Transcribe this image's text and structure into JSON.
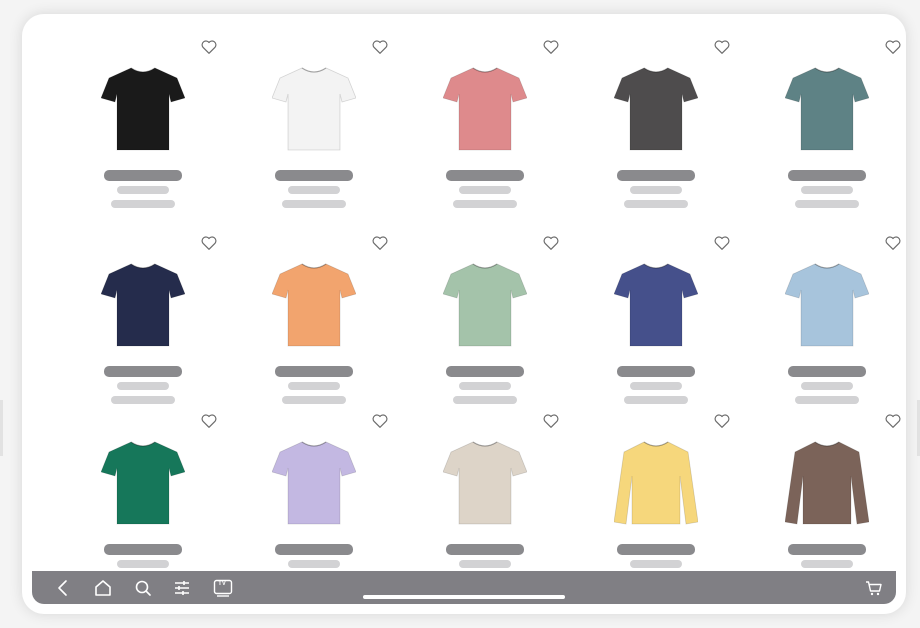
{
  "grid": {
    "products": [
      {
        "color": "#1a1a1a",
        "style": "short"
      },
      {
        "color": "#f3f3f3",
        "style": "short"
      },
      {
        "color": "#de8a8c",
        "style": "short"
      },
      {
        "color": "#4e4c4d",
        "style": "short"
      },
      {
        "color": "#5e8285",
        "style": "short"
      },
      {
        "color": "#252c4c",
        "style": "short"
      },
      {
        "color": "#f2a46e",
        "style": "short"
      },
      {
        "color": "#a4c3aa",
        "style": "short"
      },
      {
        "color": "#45508b",
        "style": "short"
      },
      {
        "color": "#a7c4dc",
        "style": "short"
      },
      {
        "color": "#16775a",
        "style": "short"
      },
      {
        "color": "#c3b8e2",
        "style": "short"
      },
      {
        "color": "#ddd4c8",
        "style": "short"
      },
      {
        "color": "#f6d77c",
        "style": "long"
      },
      {
        "color": "#7b6359",
        "style": "long"
      }
    ]
  },
  "navbar": {
    "items": [
      "back-icon",
      "home-icon",
      "search-icon",
      "filter-icon",
      "tv-icon"
    ],
    "tv_label": "TV",
    "cart": "cart-icon"
  },
  "colors": {
    "navbar": "#807f84",
    "placeholder_dark": "#8a8a8d",
    "placeholder_light": "#d2d2d4"
  }
}
